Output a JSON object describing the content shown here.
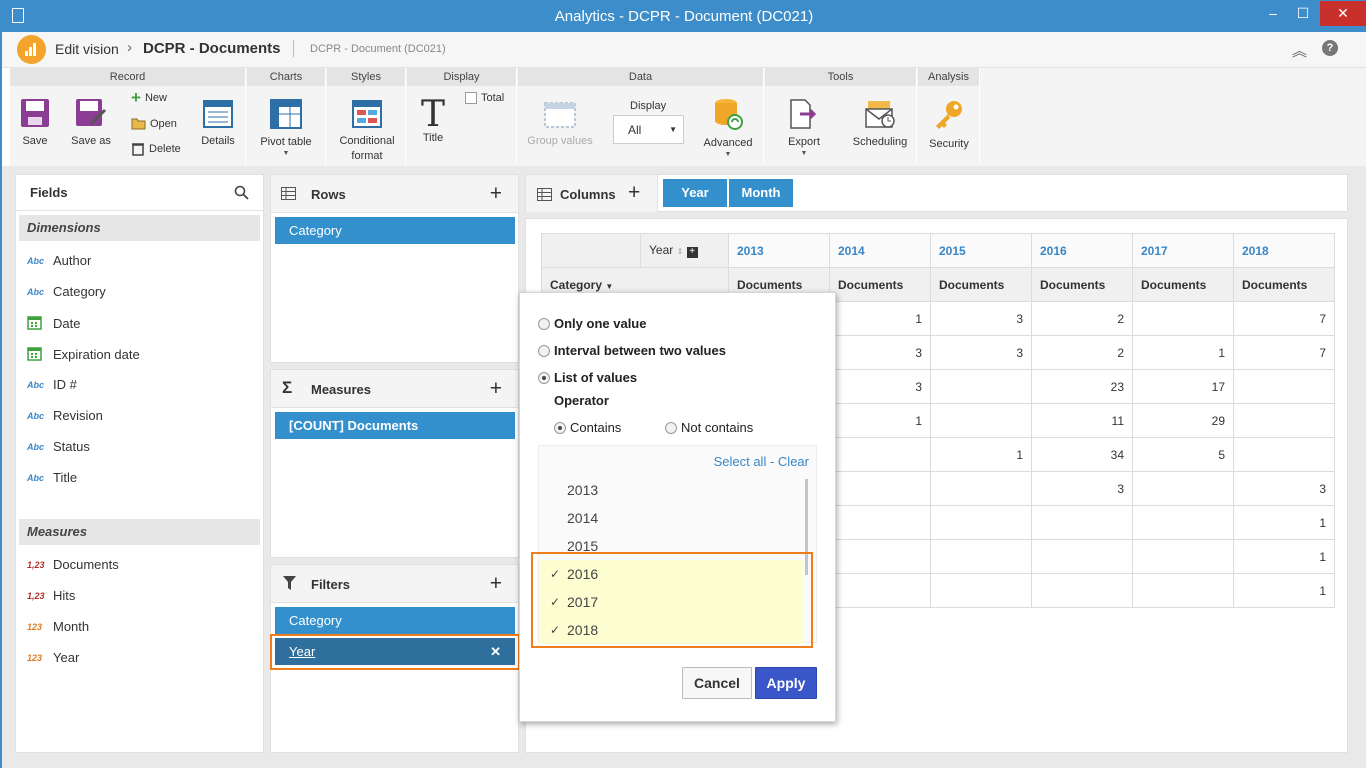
{
  "window": {
    "title": "Analytics - DCPR - Document (DC021)",
    "minimize": "–",
    "maximize": "☐",
    "close": "✕"
  },
  "header": {
    "edit_vision": "Edit vision",
    "separator": "›",
    "vision_name": "DCPR - Documents",
    "subtitle": "DCPR - Document (DC021)",
    "collapse_glyph": "︽",
    "help_glyph": "?"
  },
  "ribbon": {
    "groups": {
      "record": "Record",
      "charts": "Charts",
      "styles": "Styles",
      "display": "Display",
      "data": "Data",
      "tools": "Tools",
      "analysis": "Analysis"
    },
    "save": "Save",
    "save_as": "Save as",
    "new": "New",
    "open": "Open",
    "delete": "Delete",
    "details": "Details",
    "pivot_table": "Pivot table",
    "conditional_format_1": "Conditional",
    "conditional_format_2": "format",
    "title": "Title",
    "title_glyph": "T",
    "total": "Total",
    "group_values": "Group values",
    "display_label": "Display",
    "display_value": "All",
    "advanced": "Advanced",
    "export": "Export",
    "scheduling": "Scheduling",
    "security": "Security",
    "caret": "▼"
  },
  "fields_panel": {
    "title": "Fields",
    "dimensions_header": "Dimensions",
    "dimensions": [
      {
        "icon": "Abc",
        "label": "Author"
      },
      {
        "icon": "Abc",
        "label": "Category"
      },
      {
        "icon": "calendar",
        "label": "Date"
      },
      {
        "icon": "calendar",
        "label": "Expiration date"
      },
      {
        "icon": "Abc",
        "label": "ID #"
      },
      {
        "icon": "Abc",
        "label": "Revision"
      },
      {
        "icon": "Abc",
        "label": "Status"
      },
      {
        "icon": "Abc",
        "label": "Title"
      }
    ],
    "measures_header": "Measures",
    "measures": [
      {
        "icon": "1,23",
        "label": "Documents"
      },
      {
        "icon": "1,23",
        "label": "Hits"
      },
      {
        "icon": "123",
        "label": "Month"
      },
      {
        "icon": "123",
        "label": "Year"
      }
    ]
  },
  "rows_panel": {
    "title": "Rows",
    "plus": "+",
    "items": [
      "Category"
    ]
  },
  "measures_panel": {
    "title": "Measures",
    "plus": "+",
    "items": [
      "[COUNT] Documents"
    ]
  },
  "filters_panel": {
    "title": "Filters",
    "plus": "+",
    "items": [
      "Category",
      "Year"
    ],
    "remove_glyph": "✕"
  },
  "columns_bar": {
    "title": "Columns",
    "plus": "+",
    "chips": [
      "Year",
      "Month"
    ]
  },
  "pivot": {
    "year_label": "Year",
    "category_label": "Category",
    "years": [
      "2013",
      "2014",
      "2015",
      "2016",
      "2017",
      "2018"
    ],
    "measure_label": "Documents",
    "rows": [
      [
        "",
        "1",
        "3",
        "2",
        "",
        "7"
      ],
      [
        "",
        "3",
        "3",
        "2",
        "1",
        "7"
      ],
      [
        "",
        "3",
        "",
        "23",
        "17",
        ""
      ],
      [
        "",
        "1",
        "",
        "11",
        "29",
        ""
      ],
      [
        "",
        "",
        "1",
        "34",
        "5",
        ""
      ],
      [
        "",
        "",
        "",
        "3",
        "",
        "3"
      ],
      [
        "",
        "",
        "",
        "",
        "",
        "1"
      ],
      [
        "",
        "",
        "",
        "",
        "",
        "1"
      ],
      [
        "",
        "",
        "",
        "",
        "",
        "1"
      ]
    ]
  },
  "filter_popup": {
    "only_one_value": "Only one value",
    "interval": "Interval between two values",
    "list_of_values": "List of values",
    "operator": "Operator",
    "contains": "Contains",
    "not_contains": "Not contains",
    "select_all": "Select all",
    "dash": "-",
    "clear": "Clear",
    "values": [
      {
        "label": "2013",
        "checked": false
      },
      {
        "label": "2014",
        "checked": false
      },
      {
        "label": "2015",
        "checked": false
      },
      {
        "label": "2016",
        "checked": true
      },
      {
        "label": "2017",
        "checked": true
      },
      {
        "label": "2018",
        "checked": true
      }
    ],
    "check_glyph": "✓",
    "cancel": "Cancel",
    "apply": "Apply"
  },
  "colors": {
    "accent": "#3390cd",
    "title_bar": "#3c8dca",
    "highlight": "#ef7d1c",
    "apply_button": "#3a57c9",
    "selected_year_bg": "#2f6f9e"
  }
}
